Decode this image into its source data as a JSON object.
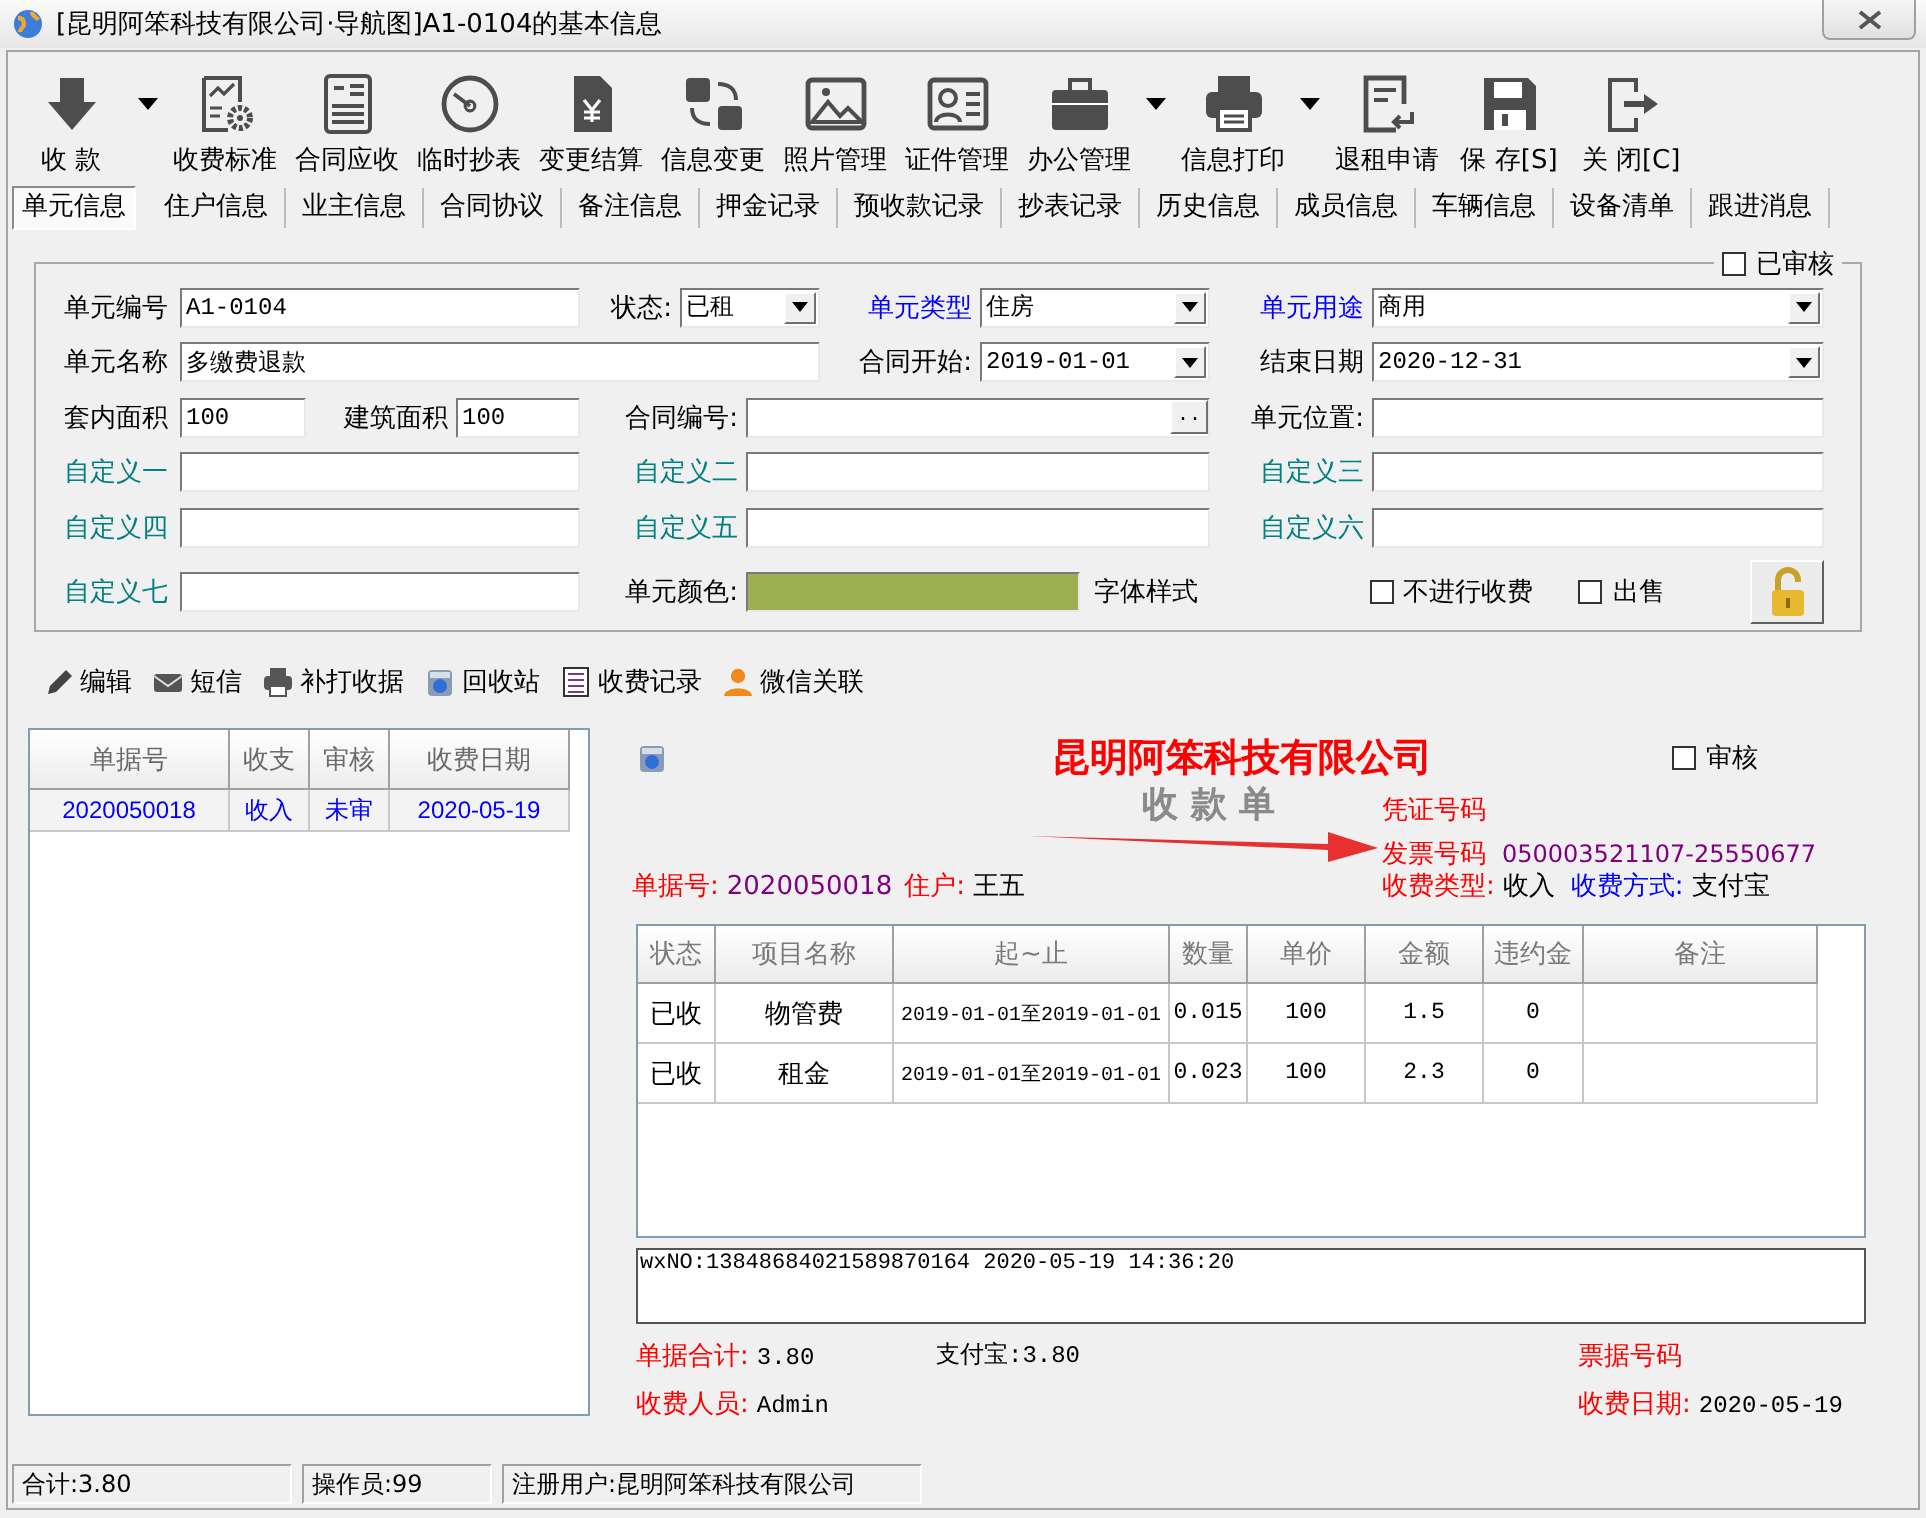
{
  "window": {
    "title": "[昆明阿笨科技有限公司·导航图]A1-0104的基本信息"
  },
  "toolbar": [
    {
      "label": "收 款",
      "dropdown": true
    },
    {
      "label": "收费标准",
      "dropdown": false
    },
    {
      "label": "合同应收",
      "dropdown": false
    },
    {
      "label": "临时抄表",
      "dropdown": false
    },
    {
      "label": "变更结算",
      "dropdown": false
    },
    {
      "label": "信息变更",
      "dropdown": false
    },
    {
      "label": "照片管理",
      "dropdown": false
    },
    {
      "label": "证件管理",
      "dropdown": false
    },
    {
      "label": "办公管理",
      "dropdown": true
    },
    {
      "label": "信息打印",
      "dropdown": true
    },
    {
      "label": "退租申请",
      "dropdown": false
    },
    {
      "label": "保 存[S]",
      "dropdown": false
    },
    {
      "label": "关 闭[C]",
      "dropdown": false
    }
  ],
  "tabs": [
    {
      "label": "单元信息",
      "selected": true
    },
    {
      "label": "住户信息",
      "selected": false
    },
    {
      "label": "业主信息",
      "selected": false
    },
    {
      "label": "合同协议",
      "selected": false
    },
    {
      "label": "备注信息",
      "selected": false
    },
    {
      "label": "押金记录",
      "selected": false
    },
    {
      "label": "预收款记录",
      "selected": false
    },
    {
      "label": "抄表记录",
      "selected": false
    },
    {
      "label": "历史信息",
      "selected": false
    },
    {
      "label": "成员信息",
      "selected": false
    },
    {
      "label": "车辆信息",
      "selected": false
    },
    {
      "label": "设备清单",
      "selected": false
    },
    {
      "label": "跟进消息",
      "selected": false
    }
  ],
  "form": {
    "approved": {
      "label": "已审核",
      "checked": false
    },
    "rows": [
      {
        "fields": [
          {
            "label": {
              "text": "单元编号",
              "color": "#000000"
            },
            "kind": "text",
            "value": "A1-0104"
          },
          {
            "label": {
              "text": "状态:",
              "color": "#000000"
            },
            "kind": "dropdown",
            "value": "已租"
          },
          {
            "label": {
              "text": "单元类型",
              "color": "#0000ff"
            },
            "kind": "dropdown",
            "value": "住房"
          },
          {
            "label": {
              "text": "单元用途",
              "color": "#0000ff"
            },
            "kind": "dropdown",
            "value": "商用"
          }
        ]
      },
      {
        "fields": [
          {
            "label": {
              "text": "单元名称",
              "color": "#000000"
            },
            "kind": "text",
            "value": "多缴费退款"
          },
          {
            "label": {
              "text": "合同开始:",
              "color": "#000000"
            },
            "kind": "dropdown",
            "value": "2019-01-01"
          },
          {
            "label": {
              "text": "结束日期",
              "color": "#000000"
            },
            "kind": "dropdown",
            "value": "2020-12-31"
          }
        ]
      },
      {
        "fields": [
          {
            "label": {
              "text": "套内面积",
              "color": "#000000"
            },
            "kind": "text",
            "value": "100"
          },
          {
            "label": {
              "text": "建筑面积",
              "color": "#000000"
            },
            "kind": "text",
            "value": "100"
          },
          {
            "label": {
              "text": "合同编号:",
              "color": "#000000"
            },
            "kind": "browse",
            "button": ".."
          },
          {
            "label": {
              "text": "单元位置:",
              "color": "#000000"
            },
            "kind": "text"
          }
        ]
      },
      {
        "fields": [
          {
            "label": {
              "text": "自定义一",
              "color": "#008080"
            },
            "kind": "text"
          },
          {
            "label": {
              "text": "自定义二",
              "color": "#008080"
            },
            "kind": "text"
          },
          {
            "label": {
              "text": "自定义三",
              "color": "#008080"
            },
            "kind": "text"
          }
        ]
      },
      {
        "fields": [
          {
            "label": {
              "text": "自定义四",
              "color": "#008080"
            },
            "kind": "text"
          },
          {
            "label": {
              "text": "自定义五",
              "color": "#008080"
            },
            "kind": "text"
          },
          {
            "label": {
              "text": "自定义六",
              "color": "#008080"
            },
            "kind": "text"
          }
        ]
      },
      {
        "fields": [
          {
            "label": {
              "text": "自定义七",
              "color": "#008080"
            },
            "kind": "text"
          },
          {
            "label": {
              "text": "单元颜色:",
              "color": "#000000"
            },
            "kind": "color",
            "color": "#9caf52"
          }
        ]
      }
    ],
    "font_style": "字体样式",
    "options": [
      {
        "label": "不进行收费",
        "checked": false
      },
      {
        "label": "出售",
        "checked": false
      }
    ]
  },
  "actions": [
    {
      "label": "编辑"
    },
    {
      "label": "短信"
    },
    {
      "label": "补打收据"
    },
    {
      "label": "回收站"
    },
    {
      "label": "收费记录"
    },
    {
      "label": "微信关联"
    }
  ],
  "records": {
    "columns": [
      "单据号",
      "收支",
      "审核",
      "收费日期"
    ],
    "rows": [
      {
        "cells": [
          "2020050018",
          "收入",
          "未审",
          "2020-05-19"
        ]
      }
    ]
  },
  "receipt": {
    "company": "昆明阿笨科技有限公司",
    "approved": {
      "label": "审核",
      "checked": false
    },
    "title": "收 款 单",
    "voucher_label": "凭证号码",
    "invoice_label": "发票号码",
    "invoice_no": "050003521107-25550677",
    "info_left": [
      {
        "label": {
          "text": "单据号:",
          "color": "#ff0000"
        },
        "value": {
          "text": "2020050018",
          "color": "#800080"
        }
      },
      {
        "label": {
          "text": "住户:",
          "color": "#ff0000"
        },
        "value": {
          "text": "王五",
          "color": "#000000"
        }
      }
    ],
    "info_right": [
      {
        "label": {
          "text": "收费类型:",
          "color": "#ff0000"
        },
        "value": {
          "text": "收入",
          "color": "#000000"
        }
      },
      {
        "label": {
          "text": "收费方式:",
          "color": "#0000ff"
        },
        "value": {
          "text": "支付宝",
          "color": "#000000"
        }
      }
    ],
    "columns": [
      "状态",
      "项目名称",
      "起~止",
      "数量",
      "单价",
      "金额",
      "违约金",
      "备注"
    ],
    "rows": [
      [
        "已收",
        "物管费",
        "2019-01-01至2019-01-01",
        "0.015",
        "100",
        "1.5",
        "0",
        ""
      ],
      [
        "已收",
        "租金",
        "2019-01-01至2019-01-01",
        "0.023",
        "100",
        "2.3",
        "0",
        ""
      ]
    ],
    "note": "wxNO:13848684021589870164 2020-05-19 14:36:20",
    "total": {
      "label": "单据合计:",
      "value": "3.80"
    },
    "alipay": "支付宝:3.80",
    "ticket_label": "票据号码",
    "cashier": {
      "label": "收费人员:",
      "value": "Admin"
    },
    "date": {
      "label": "收费日期:",
      "value": "2020-05-19"
    }
  },
  "status_bar": [
    "合计:3.80",
    "操作员:99",
    "注册用户:昆明阿笨科技有限公司"
  ]
}
